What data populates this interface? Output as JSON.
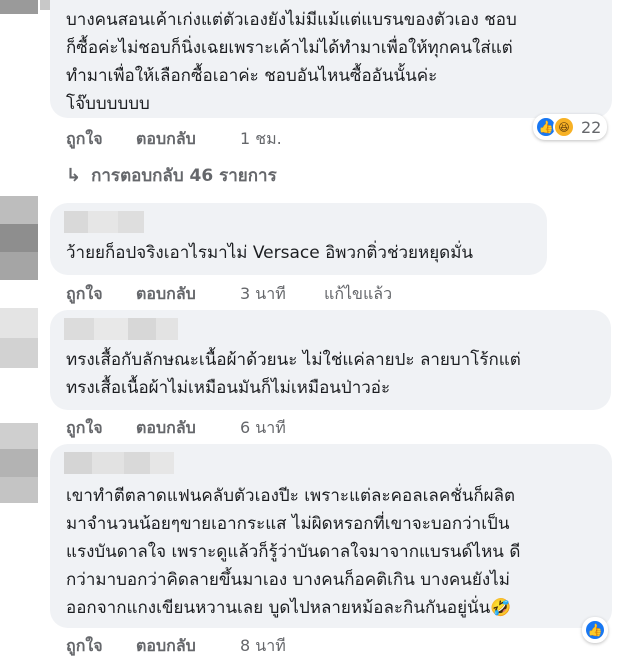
{
  "comments": [
    {
      "text": "บางคนสอนเค้าเก่งแต่ตัวเองยังไม่มีแม้แต่แบรนของตัวเอง ชอบ\nก็ซื้อค่ะไม่ชอบก็นิ่งเฉยเพราะเค้าไม่ได้ทำมาเพื่อให้ทุกคนใส่แต่\nทำมาเพื่อให้เลือกซื้อเอาค่ะ ชอบอันไหนซื้ออันนั้นค่ะ\nโจ๊บบบบบบ",
      "like": "ถูกใจ",
      "reply": "ตอบกลับ",
      "time": "1 ชม.",
      "reaction_count": "22"
    },
    {
      "text": "ว้ายยก็อปจริงเอาไรมาไม่ Versace อิพวกติ่วช่วยหยุดมั่น",
      "like": "ถูกใจ",
      "reply": "ตอบกลับ",
      "time": "3 นาที",
      "edited": "แก้ไขแล้ว"
    },
    {
      "text": "ทรงเสื้อกับลักษณะเนื้อผ้าด้วยนะ ไม่ใช่แค่ลายปะ ลายบาโร้กแต่\nทรงเสื้อเนื้อผ้าไม่เหมือนมันก็ไม่เหมือนป่าวอ่ะ",
      "like": "ถูกใจ",
      "reply": "ตอบกลับ",
      "time": "6 นาที"
    },
    {
      "text": "เขาทำตีตลาดแฟนคลับตัวเองปีะ เพราะแต่ละคอลเลคชั่นก็ผลิต\nมาจำนวนน้อยๆขายเอากระแส ไม่ผิดหรอกที่เขาจะบอกว่าเป็น\nแรงบันดาลใจ เพราะดูแล้วก็รู้ว่าบันดาลใจมาจากแบรนด์ไหน ดี\nกว่ามาบอกว่าคิดลายขึ้นมาเอง บางคนก็อคติเกิน บางคนยังไม่\nออกจากแกงเขียนหวานเลย บูดไปหลายหม้อละกินกันอยู่นั่น🤣",
      "like": "ถูกใจ",
      "reply": "ตอบกลับ",
      "time": "8 นาที"
    }
  ],
  "replies_label": "การตอบกลับ 46 รายการ",
  "icons": {
    "like": "like-reaction-icon",
    "haha": "haha-reaction-icon",
    "reply_arrow": "reply-arrow-icon"
  },
  "colors": {
    "bubble": "#f0f2f5",
    "meta": "#65676b",
    "like_blue": "#1877f2"
  }
}
